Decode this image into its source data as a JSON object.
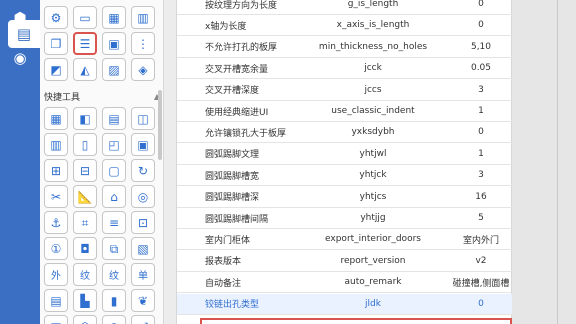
{
  "rail": {
    "items": [
      {
        "icon": "cube-icon",
        "glyph": "⬢"
      },
      {
        "icon": "document-icon",
        "glyph": "▤",
        "active": true
      },
      {
        "icon": "settings-circle-icon",
        "glyph": "◉"
      }
    ]
  },
  "panel": {
    "top_tools": [
      {
        "icon": "gear-icon",
        "glyph": "⚙"
      },
      {
        "icon": "folder-settings-icon",
        "glyph": "▭"
      },
      {
        "icon": "calculator-icon",
        "glyph": "▦"
      },
      {
        "icon": "sheet-icon",
        "glyph": "▥"
      },
      {
        "icon": "copy-icon",
        "glyph": "❐"
      },
      {
        "icon": "parameter-list-icon",
        "glyph": "☰",
        "selected": true
      },
      {
        "icon": "clipboard-gear-icon",
        "glyph": "▣"
      },
      {
        "icon": "tree-list-icon",
        "glyph": "⋮"
      },
      {
        "icon": "box-edit-icon",
        "glyph": "◩"
      },
      {
        "icon": "paint-icon",
        "glyph": "◭"
      },
      {
        "icon": "layer-edit-icon",
        "glyph": "▨"
      },
      {
        "icon": "cube-check-icon",
        "glyph": "◈"
      }
    ],
    "section_title": "快捷工具",
    "quick_tools": [
      {
        "icon": "grid-icon",
        "glyph": "▦"
      },
      {
        "icon": "cube-split-icon",
        "glyph": "◧"
      },
      {
        "icon": "board-icon",
        "glyph": "▤"
      },
      {
        "icon": "board-eye-icon",
        "glyph": "◫"
      },
      {
        "icon": "panel-icon",
        "glyph": "▥"
      },
      {
        "icon": "door-icon",
        "glyph": "▯"
      },
      {
        "icon": "corner-icon",
        "glyph": "◰"
      },
      {
        "icon": "window-icon",
        "glyph": "▣"
      },
      {
        "icon": "board-add-icon",
        "glyph": "⊞"
      },
      {
        "icon": "drill-icon",
        "glyph": "⊟"
      },
      {
        "icon": "box-icon",
        "glyph": "▢"
      },
      {
        "icon": "refresh-icon",
        "glyph": "↻"
      },
      {
        "icon": "cut-icon",
        "glyph": "✂"
      },
      {
        "icon": "ruler-icon",
        "glyph": "📐"
      },
      {
        "icon": "tag-icon",
        "glyph": "⌂"
      },
      {
        "icon": "target-icon",
        "glyph": "◎"
      },
      {
        "icon": "anchor-icon",
        "glyph": "⚓"
      },
      {
        "icon": "crop-icon",
        "glyph": "⌗"
      },
      {
        "icon": "align-icon",
        "glyph": "≡"
      },
      {
        "icon": "dimension-icon",
        "glyph": "⊡"
      },
      {
        "icon": "number-one-icon",
        "glyph": "①"
      },
      {
        "icon": "shape-icon",
        "glyph": "◘"
      },
      {
        "icon": "stack-icon",
        "glyph": "⧉"
      },
      {
        "icon": "hatch-icon",
        "glyph": "▧"
      },
      {
        "icon": "outside-text-icon",
        "text": "外"
      },
      {
        "icon": "pattern-text-icon",
        "text": "纹"
      },
      {
        "icon": "grain-text-icon",
        "text": "纹"
      },
      {
        "icon": "single-text-icon",
        "text": "单"
      },
      {
        "icon": "shelf-icon",
        "glyph": "▤"
      },
      {
        "icon": "flip-icon",
        "glyph": "▙"
      },
      {
        "icon": "bars-icon",
        "glyph": "▮"
      },
      {
        "icon": "leaf-icon",
        "glyph": "❦"
      },
      {
        "icon": "panel-corner-icon",
        "glyph": "◳"
      },
      {
        "icon": "box-3d-icon",
        "glyph": "⬡"
      },
      {
        "icon": "move-icon",
        "glyph": "⊕"
      },
      {
        "icon": "expand-red-icon",
        "glyph": "⤢"
      }
    ]
  },
  "table": {
    "rows": [
      {
        "name": "按纹理方向为长度",
        "key": "g_is_length",
        "value": "0"
      },
      {
        "name": "x轴为长度",
        "key": "x_axis_is_length",
        "value": "0"
      },
      {
        "name": "不允许打孔的板厚",
        "key": "min_thickness_no_holes",
        "value": "5,10"
      },
      {
        "name": "交叉开槽宽余量",
        "key": "jcck",
        "value": "0.05"
      },
      {
        "name": "交叉开槽深度",
        "key": "jccs",
        "value": "3"
      },
      {
        "name": "使用经典缩进UI",
        "key": "use_classic_indent",
        "value": "1"
      },
      {
        "name": "允许镶锁孔大于板厚",
        "key": "yxksdybh",
        "value": "0"
      },
      {
        "name": "圆弧踢脚文理",
        "key": "yhtjwl",
        "value": "1"
      },
      {
        "name": "圆弧踢脚槽宽",
        "key": "yhtjck",
        "value": "3"
      },
      {
        "name": "圆弧踢脚槽深",
        "key": "yhtjcs",
        "value": "16"
      },
      {
        "name": "圆弧踢脚槽间隔",
        "key": "yhtjjg",
        "value": "5"
      },
      {
        "name": "室内门柜体",
        "key": "export_interior_doors",
        "value": "室内外门"
      },
      {
        "name": "报表版本",
        "key": "report_version",
        "value": "v2"
      },
      {
        "name": "自动备注",
        "key": "auto_remark",
        "value": "碰撞槽,侧面槽"
      },
      {
        "name": "铰链出孔类型",
        "key": "jldk",
        "value": "0",
        "highlight": true
      }
    ]
  }
}
